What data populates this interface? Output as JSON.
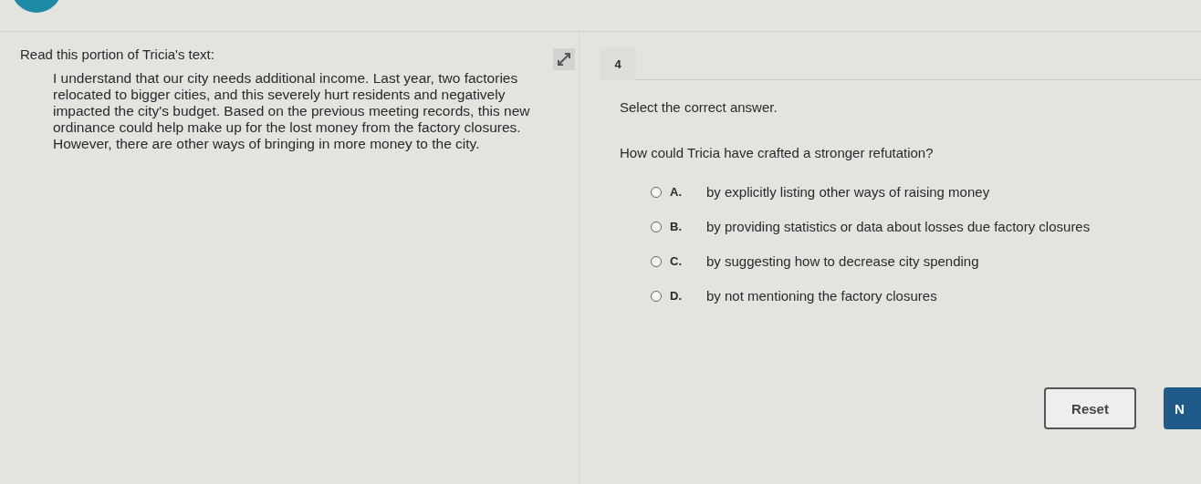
{
  "passage": {
    "heading": "Read this portion of Tricia's text:",
    "text": "I understand that our city needs additional income. Last year, two factories relocated to bigger cities, and this severely hurt residents and negatively impacted the city's budget. Based on the previous meeting records, this new ordinance could help make up for the lost money from the factory closures. However, there are other ways of bringing in more money to the city."
  },
  "question": {
    "number": "4",
    "instruction": "Select the correct answer.",
    "prompt": "How could Tricia have crafted a stronger refutation?",
    "options": [
      {
        "letter": "A.",
        "text": "by explicitly listing other ways of raising money",
        "selected": false
      },
      {
        "letter": "B.",
        "text": "by providing statistics or data about losses due factory closures",
        "selected": false
      },
      {
        "letter": "C.",
        "text": "by suggesting how to decrease city spending",
        "selected": false
      },
      {
        "letter": "D.",
        "text": "by not mentioning the factory closures",
        "selected": false
      }
    ]
  },
  "buttons": {
    "reset": "Reset",
    "next": "N"
  }
}
